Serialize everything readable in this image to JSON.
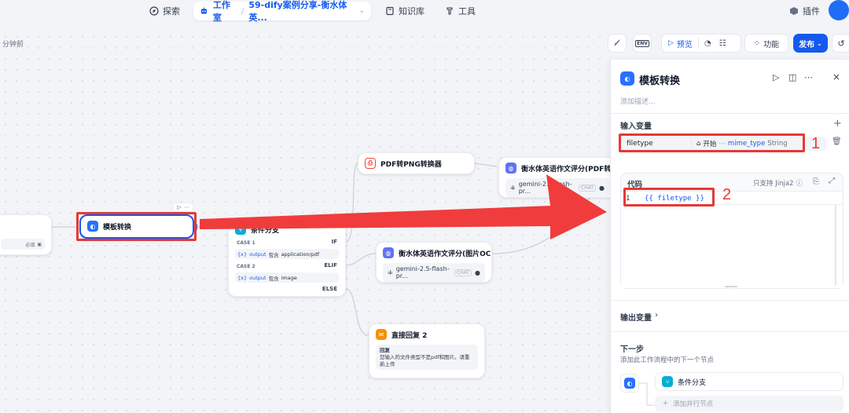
{
  "nav": {
    "explore": "探索",
    "studio": "工作室",
    "app_name": "59-dify案例分享-衡水体英...",
    "knowledge": "知识库",
    "tools": "工具",
    "plugins": "插件"
  },
  "toolbar": {
    "saved_time": "分钟前",
    "env_label": "ENV",
    "preview": "预览",
    "features": "功能",
    "publish": "发布"
  },
  "nodes": {
    "left_partial_badge": "必填",
    "template": "模板转换",
    "condition": {
      "title": "条件分支",
      "case1": "CASE 1",
      "if": "IF",
      "case1_var": "output",
      "case1_op": "包含",
      "case1_val": "application/pdf",
      "case2": "CASE 2",
      "elif": "ELIF",
      "case2_var": "output",
      "case2_op": "包含",
      "case2_val": "image",
      "else": "ELSE"
    },
    "pdf2png": "PDF转PNG转换器",
    "llm1": {
      "title": "衡水体英语作文评分(PDF转图片",
      "model": "gemini-2.5-flash-pr...",
      "tag": "CHAT"
    },
    "llm2": {
      "title": "衡水体英语作文评分(图片OCR)",
      "model": "gemini-2.5-flash-pr...",
      "tag": "CHAT"
    },
    "reply": {
      "title": "直接回复 2",
      "label": "回复",
      "text": "您输入的文件类型不是pdf和图片。请重新上传"
    }
  },
  "panel": {
    "title": "模板转换",
    "desc_placeholder": "添加描述...",
    "input_vars": "输入变量",
    "var_name": "filetype",
    "var_source": "开始",
    "var_field": "mime_type",
    "var_type": "String",
    "code_label": "代码",
    "jinja_note": "只支持 Jinja2",
    "line_no": "1",
    "code": "{{ filetype }}",
    "output_vars": "输出变量",
    "next_step": "下一步",
    "next_desc": "添加此工作流程中的下一个节点",
    "next_node": "条件分支",
    "add_parallel": "添加并行节点"
  },
  "annotations": {
    "one": "1",
    "two": "2"
  },
  "colors": {
    "accent": "#155aef",
    "red": "#e53935",
    "condition": "#06aed4",
    "llm": "#6172f3",
    "reply": "#f79009"
  }
}
